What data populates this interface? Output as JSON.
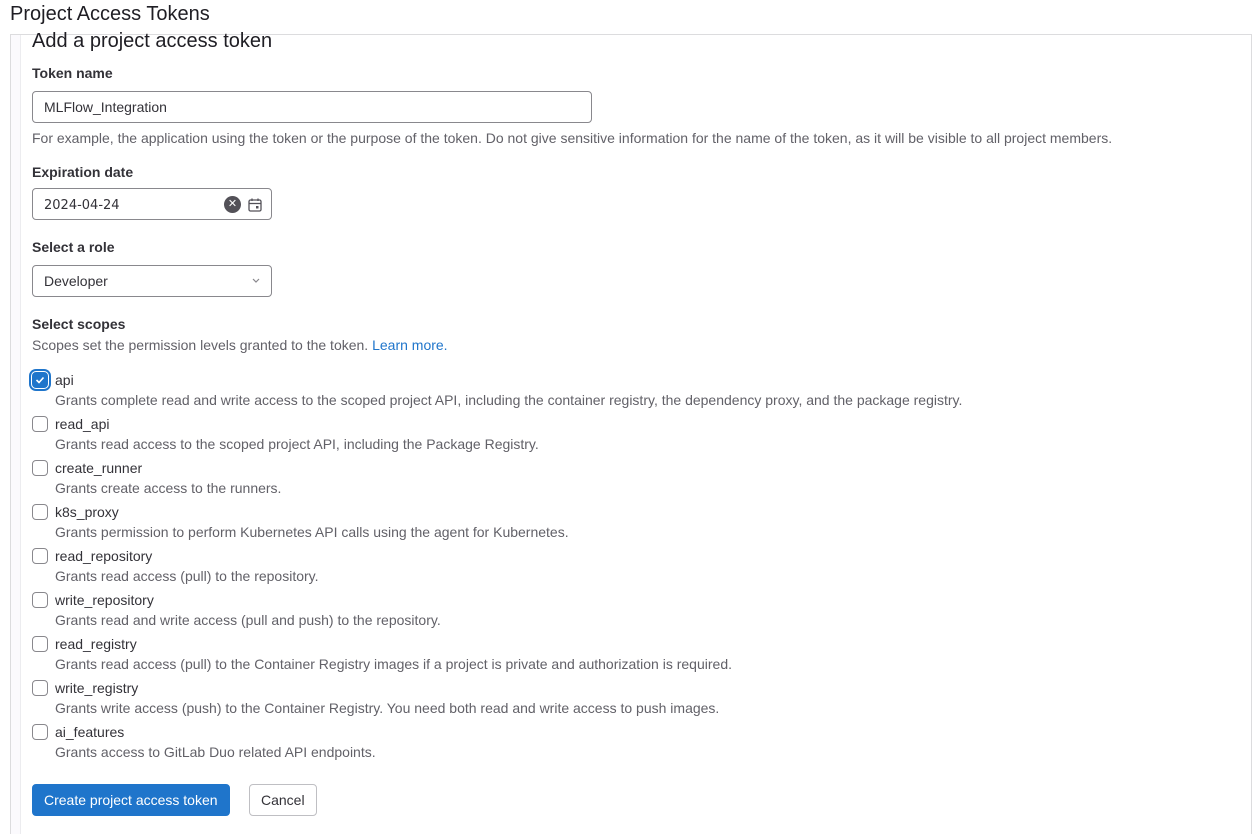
{
  "page": {
    "title": "Project Access Tokens"
  },
  "form": {
    "title": "Add a project access token",
    "token_name": {
      "label": "Token name",
      "value": "MLFlow_Integration",
      "help": "For example, the application using the token or the purpose of the token. Do not give sensitive information for the name of the token, as it will be visible to all project members."
    },
    "expiration": {
      "label": "Expiration date",
      "value": "2024-04-24",
      "clear_icon": "clear-icon",
      "calendar_icon": "calendar-icon"
    },
    "role": {
      "label": "Select a role",
      "selected": "Developer",
      "chevron": "⌄"
    },
    "scopes": {
      "label": "Select scopes",
      "help": "Scopes set the permission levels granted to the token.",
      "learn_more": "Learn more.",
      "items": [
        {
          "name": "api",
          "checked": true,
          "description": "Grants complete read and write access to the scoped project API, including the container registry, the dependency proxy, and the package registry."
        },
        {
          "name": "read_api",
          "checked": false,
          "description": "Grants read access to the scoped project API, including the Package Registry."
        },
        {
          "name": "create_runner",
          "checked": false,
          "description": "Grants create access to the runners."
        },
        {
          "name": "k8s_proxy",
          "checked": false,
          "description": "Grants permission to perform Kubernetes API calls using the agent for Kubernetes."
        },
        {
          "name": "read_repository",
          "checked": false,
          "description": "Grants read access (pull) to the repository."
        },
        {
          "name": "write_repository",
          "checked": false,
          "description": "Grants read and write access (pull and push) to the repository."
        },
        {
          "name": "read_registry",
          "checked": false,
          "description": "Grants read access (pull) to the Container Registry images if a project is private and authorization is required."
        },
        {
          "name": "write_registry",
          "checked": false,
          "description": "Grants write access (push) to the Container Registry. You need both read and write access to push images."
        },
        {
          "name": "ai_features",
          "checked": false,
          "description": "Grants access to GitLab Duo related API endpoints."
        }
      ]
    },
    "buttons": {
      "create": "Create project access token",
      "cancel": "Cancel"
    }
  },
  "colors": {
    "primary": "#1f75cb",
    "text": "#333238",
    "muted": "#626168",
    "border": "#89888d"
  }
}
